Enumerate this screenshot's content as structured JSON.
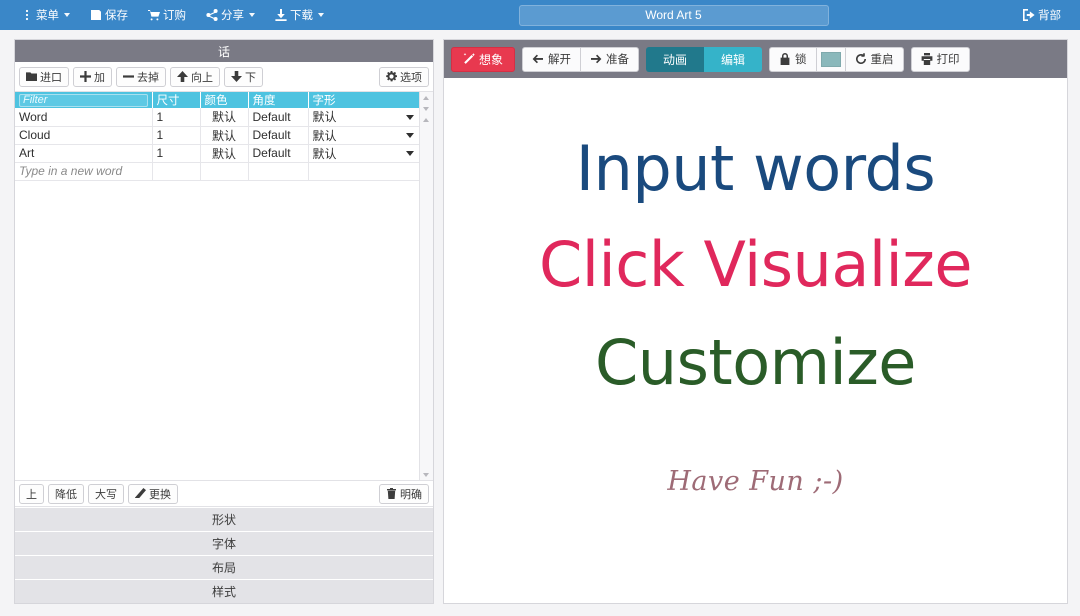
{
  "navbar": {
    "brand_color": "#3a87c8",
    "items": [
      {
        "label": "菜单",
        "icon": "vertical-dots-icon",
        "caret": true
      },
      {
        "label": "保存",
        "icon": "save-icon",
        "caret": false
      },
      {
        "label": "订购",
        "icon": "cart-icon",
        "caret": false
      },
      {
        "label": "分享",
        "icon": "share-icon",
        "caret": true
      },
      {
        "label": "下载",
        "icon": "download-icon",
        "caret": true
      }
    ],
    "title_value": "Word Art 5",
    "title_placeholder": "Word Art 5",
    "back": {
      "label": "背部",
      "icon": "logout-icon"
    }
  },
  "left_panel": {
    "header_title": "话",
    "toolbar": [
      {
        "label": "进口",
        "icon": "import-icon"
      },
      {
        "label": "加",
        "icon": "plus-icon"
      },
      {
        "label": "去掉",
        "icon": "minus-icon"
      },
      {
        "label": "向上",
        "icon": "arrow-up-icon"
      },
      {
        "label": "下",
        "icon": "arrow-down-icon"
      }
    ],
    "options_button": {
      "label": "选项",
      "icon": "gear-icon"
    },
    "table": {
      "filter_placeholder": "Filter",
      "filter_value": "",
      "columns": [
        "Filter",
        "尺寸",
        "颜色",
        "角度",
        "字形"
      ],
      "header_color": "#4ec3e0",
      "rows": [
        {
          "word": "Word",
          "size": "1",
          "color": "默认",
          "angle": "Default",
          "font": "默认"
        },
        {
          "word": "Cloud",
          "size": "1",
          "color": "默认",
          "angle": "Default",
          "font": "默认"
        },
        {
          "word": "Art",
          "size": "1",
          "color": "默认",
          "angle": "Default",
          "font": "默认"
        }
      ],
      "new_row_placeholder": "Type in a new word"
    },
    "bottom_toolbar": [
      {
        "label": "上",
        "icon": ""
      },
      {
        "label": "降低",
        "icon": ""
      },
      {
        "label": "大写",
        "icon": ""
      },
      {
        "label": "更换",
        "icon": "edit-icon"
      }
    ],
    "clear_button": {
      "label": "明确",
      "icon": "trash-icon"
    },
    "accordion": [
      {
        "label": "形状"
      },
      {
        "label": "字体"
      },
      {
        "label": "布局"
      },
      {
        "label": "样式"
      }
    ]
  },
  "right_panel": {
    "toolbar": {
      "visualize": {
        "label": "想象",
        "icon": "wand-icon",
        "color": "#e8394f"
      },
      "undo": {
        "label": "解开",
        "icon": "arrow-left-icon"
      },
      "redo": {
        "label": "准备",
        "icon": "arrow-right-icon"
      },
      "animate": {
        "label": "动画",
        "color": "#21798c",
        "active": true
      },
      "edit": {
        "label": "编辑",
        "color": "#35b3c9",
        "active": false
      },
      "lock": {
        "label": "锁",
        "icon": "lock-icon"
      },
      "color_swatch": {
        "value": "#8ab8bb"
      },
      "reset": {
        "label": "重启",
        "icon": "refresh-icon"
      },
      "print": {
        "label": "打印",
        "icon": "printer-icon"
      }
    }
  },
  "chart_data": {
    "type": "wordcloud",
    "title": "",
    "words": [
      {
        "text": "Input words",
        "size": 62,
        "color": "#1a4a7e",
        "weight": 1
      },
      {
        "text": "Click Visualize",
        "size": 62,
        "color": "#e0285c",
        "weight": 1
      },
      {
        "text": "Customize",
        "size": 62,
        "color": "#2a5c28",
        "weight": 1
      },
      {
        "text": "Have Fun ;-)",
        "size": 27,
        "color": "#9e6b76",
        "weight": 1
      }
    ]
  }
}
